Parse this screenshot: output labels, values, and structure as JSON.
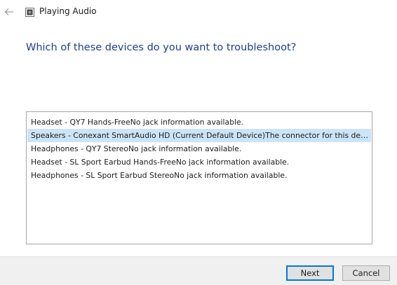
{
  "window": {
    "title": "Playing Audio"
  },
  "icons": {
    "back": "arrow-left-icon",
    "app": "audio-troubleshooter-icon"
  },
  "heading": "Which of these devices do you want to troubleshoot?",
  "devices": [
    {
      "label": "Headset - QY7 Hands-FreeNo jack information available.",
      "selected": false
    },
    {
      "label": "Speakers - Conexant SmartAudio HD (Current Default Device)The connector for this devic...",
      "selected": true
    },
    {
      "label": "Headphones - QY7 StereoNo jack information available.",
      "selected": false
    },
    {
      "label": "Headset - SL Sport Earbud Hands-FreeNo jack information available.",
      "selected": false
    },
    {
      "label": "Headphones - SL Sport Earbud StereoNo jack information available.",
      "selected": false
    }
  ],
  "buttons": {
    "next": "Next",
    "cancel": "Cancel"
  },
  "colors": {
    "heading": "#1e3f8c",
    "selection": "#cce4f7",
    "default_button_border": "#0078d7"
  }
}
